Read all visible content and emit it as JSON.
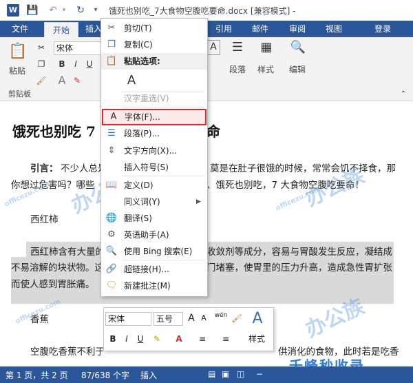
{
  "titlebar": {
    "app_icon": "W",
    "title": "饿死也别吃_7大食物空腹吃要命.docx [兼容模式] -"
  },
  "tabs": {
    "file": "文件",
    "home": "开始",
    "insert": "插入",
    "references": "引用",
    "mailings": "邮件",
    "review": "审阅",
    "view": "视图",
    "login": "登录"
  },
  "ribbon": {
    "font_name": "宋体",
    "paste_label": "粘贴",
    "clipboard_label": "剪贴板",
    "paragraph_label": "段落",
    "styles_label": "样式",
    "editing_label": "编辑",
    "bold": "B",
    "italic": "I",
    "underline": "U"
  },
  "document": {
    "heading_left": "饿死也别吃 7",
    "heading_right": "命",
    "p1_bold": "引言：",
    "p1_line1_a": "不少人总是",
    "p1_line1_b": "莫是在肚子很饿的时候，常常会饥不择食，那",
    "p1_line2_a": "你想过危害吗？哪些",
    "p1_line2_b": "、饿死也别吃，7 大食物空腹吃要命！",
    "section1": "西红柿",
    "p2_line1_a": "西红柿含有大量的",
    "p2_line1_b": "收敛剂等成分，容易与胃酸发生反应，凝结成",
    "p2_line2_a": "不易溶解的块状物。这",
    "p2_line2_b": "门堵塞，使胃里的压力升高，造成急性胃扩张",
    "p2_line3": "而使人感到胃胀痛。",
    "section2": "香蕉",
    "p3_line1_a": "空腹吃香蕉不利于",
    "p3_line1_b": "供消化的食物，此时若是吃香"
  },
  "context_menu": {
    "cut": "剪切(T)",
    "copy": "复制(C)",
    "paste_options": "粘贴选项:",
    "hanzi_reselect": "汉字重选(V)",
    "font": "字体(F)...",
    "paragraph": "段落(P)...",
    "text_direction": "文字方向(X)...",
    "insert_symbol": "插入符号(S)",
    "define": "定义(D)",
    "synonyms": "同义词(Y)",
    "translate": "翻译(S)",
    "english_assistant": "英语助手(A)",
    "bing_search": "使用 Bing 搜索(E)",
    "hyperlink": "超链接(H)...",
    "new_comment": "新建批注(M)"
  },
  "mini_toolbar": {
    "font_name": "宋体",
    "font_size": "五号",
    "styles": "样式",
    "bold": "B",
    "italic": "I",
    "underline": "U",
    "wen_label": "wén"
  },
  "statusbar": {
    "page": "第 1 页，共 2 页",
    "words": "87/638 个字",
    "mode": "插入"
  },
  "watermark": {
    "brand": "办公族",
    "domain": "officezu.com",
    "bottom_brand": "千峰秒收录"
  },
  "colors": {
    "ribbon_blue": "#2b579a",
    "highlight_red": "#d9282f"
  }
}
